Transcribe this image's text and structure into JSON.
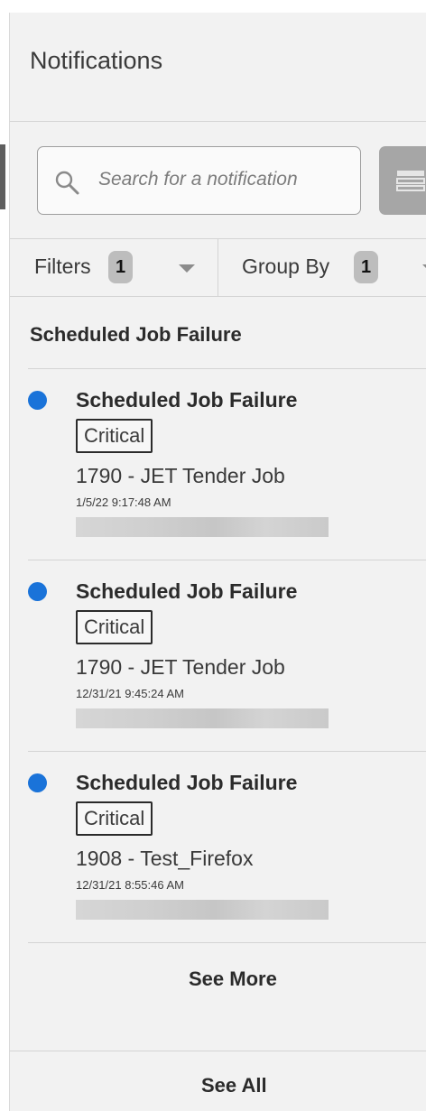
{
  "panel": {
    "title": "Notifications"
  },
  "search": {
    "placeholder": "Search for a notification",
    "icon": "search-icon"
  },
  "toolbar": {
    "view_icon": "list-view-icon"
  },
  "filters": {
    "filters_label": "Filters",
    "filters_count": "1",
    "group_by_label": "Group By",
    "group_by_count": "1"
  },
  "group": {
    "name": "Scheduled Job Failure"
  },
  "notifications": [
    {
      "title": "Scheduled Job Failure",
      "severity": "Critical",
      "description": "1790 - JET Tender Job",
      "timestamp": "1/5/22 9:17:48 AM"
    },
    {
      "title": "Scheduled Job Failure",
      "severity": "Critical",
      "description": "1790 - JET Tender Job",
      "timestamp": "12/31/21 9:45:24 AM"
    },
    {
      "title": "Scheduled Job Failure",
      "severity": "Critical",
      "description": "1908 - Test_Firefox",
      "timestamp": "12/31/21 8:55:46 AM"
    }
  ],
  "actions": {
    "see_more": "See More",
    "see_all": "See All"
  },
  "colors": {
    "unread_dot": "#1a73d9",
    "panel_bg": "#f2f2f2",
    "badge_bg": "#bdbdbd"
  }
}
